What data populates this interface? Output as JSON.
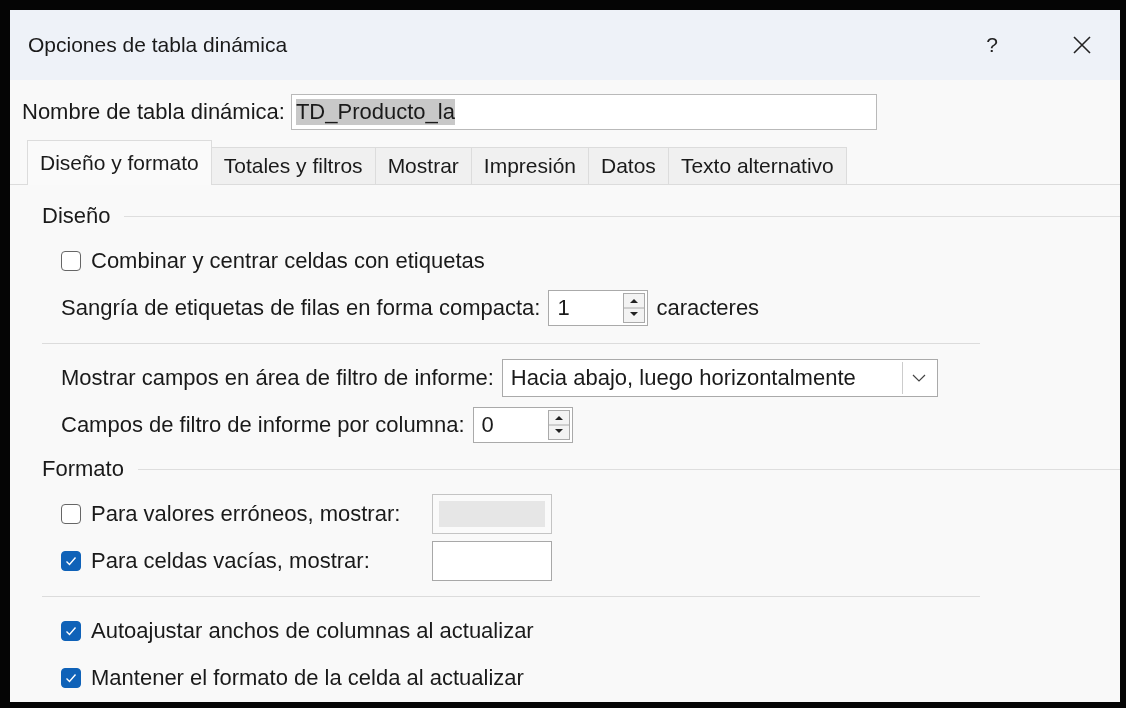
{
  "window": {
    "title": "Opciones de tabla dinámica",
    "help": "?"
  },
  "name_field": {
    "label": "Nombre de tabla dinámica:",
    "value": "TD_Producto_la",
    "text_selected": true
  },
  "tabs": [
    {
      "label": "Diseño y formato",
      "selected": true
    },
    {
      "label": "Totales y filtros",
      "selected": false
    },
    {
      "label": "Mostrar",
      "selected": false
    },
    {
      "label": "Impresión",
      "selected": false
    },
    {
      "label": "Datos",
      "selected": false
    },
    {
      "label": "Texto alternativo",
      "selected": false
    }
  ],
  "sections": [
    {
      "title": "Diseño",
      "items": [
        {
          "kind": "checkbox",
          "label": "Combinar y centrar celdas con etiquetas",
          "checked": false
        },
        {
          "kind": "spin",
          "label": "Sangría de etiquetas de filas en forma compacta:",
          "value": "1",
          "suffix": "caracteres"
        },
        {
          "kind": "separator"
        },
        {
          "kind": "dropdown",
          "label": "Mostrar campos en área de filtro de informe:",
          "value": "Hacia abajo, luego horizontalmente"
        },
        {
          "kind": "spin",
          "label": "Campos de filtro de informe por columna:",
          "value": "0"
        }
      ]
    },
    {
      "title": "Formato",
      "items": [
        {
          "kind": "checkbox_field",
          "label": "Para valores erróneos, mostrar:",
          "checked": false,
          "disabled": true
        },
        {
          "kind": "checkbox_field",
          "label": "Para celdas vacías, mostrar:",
          "checked": true,
          "disabled": false
        },
        {
          "kind": "separator"
        },
        {
          "kind": "checkbox",
          "label": "Autoajustar anchos de columnas al actualizar",
          "checked": true
        },
        {
          "kind": "checkbox",
          "label": "Mantener el formato de la celda al actualizar",
          "checked": true
        }
      ]
    }
  ]
}
